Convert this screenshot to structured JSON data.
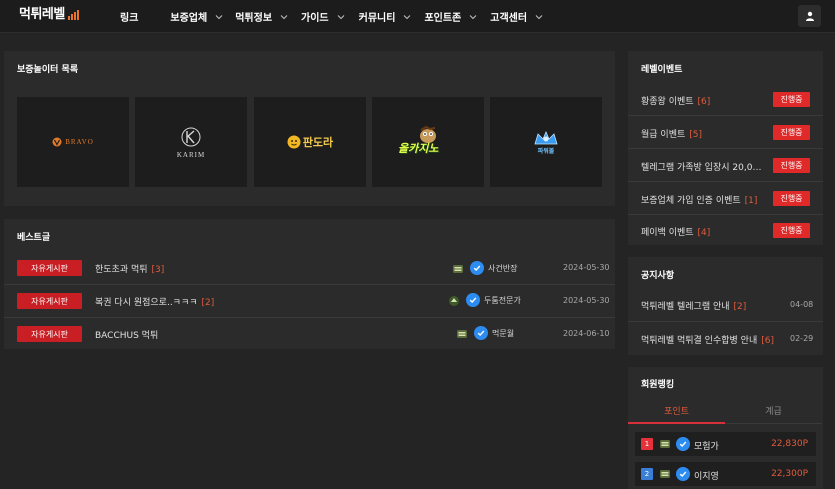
{
  "header": {
    "logo": "먹튀레벨",
    "nav": [
      {
        "label": "링크",
        "dropdown": false
      },
      {
        "label": "보증업체",
        "dropdown": true
      },
      {
        "label": "먹튀정보",
        "dropdown": true
      },
      {
        "label": "가이드",
        "dropdown": true
      },
      {
        "label": "커뮤니티",
        "dropdown": true
      },
      {
        "label": "포인트존",
        "dropdown": true
      },
      {
        "label": "고객센터",
        "dropdown": true
      }
    ],
    "user_icon": "user-icon"
  },
  "partners": {
    "title": "보증놀이터 목록",
    "items": [
      {
        "name": "BRAVO"
      },
      {
        "name": "KARIM"
      },
      {
        "name": "판도라"
      },
      {
        "name": "올카지노"
      },
      {
        "name": "파워볼"
      }
    ]
  },
  "best": {
    "title": "베스트글",
    "posts": [
      {
        "category": "자유게시판",
        "title": "한도초과 먹튀",
        "comments": "[3]",
        "author": "사건반장",
        "date": "2024-05-30"
      },
      {
        "category": "자유게시판",
        "title": "복권 다시 원점으로..ㅋㅋㅋ",
        "comments": "[2]",
        "author": "두툼전문가",
        "date": "2024-05-30"
      },
      {
        "category": "자유게시판",
        "title": "BACCHUS 먹튀",
        "comments": "",
        "author": "먹문월",
        "date": "2024-06-10"
      }
    ]
  },
  "events": {
    "title": "레벨이벤트",
    "items": [
      {
        "title": "황종왕 이벤트",
        "count": "[6]",
        "status": "진행중"
      },
      {
        "title": "월급 이벤트",
        "count": "[5]",
        "status": "진행중"
      },
      {
        "title": "텔레그램 가족방 입장시 20,000…",
        "count": "",
        "status": "진행중"
      },
      {
        "title": "보증업체 가입 인증 이벤트",
        "count": "[1]",
        "status": "진행중"
      },
      {
        "title": "페이백 이벤트",
        "count": "[4]",
        "status": "진행중"
      }
    ]
  },
  "notices": {
    "title": "공지사항",
    "items": [
      {
        "title": "먹튀레벨 텔레그램 안내",
        "count": "[2]",
        "date": "04-08"
      },
      {
        "title": "먹튀레벨 먹튀결 인수합병 안내",
        "count": "[6]",
        "date": "02-29"
      }
    ]
  },
  "ranking": {
    "title": "회원랭킹",
    "tabs": [
      {
        "label": "포인트",
        "active": true
      },
      {
        "label": "계급",
        "active": false
      }
    ],
    "rows": [
      {
        "rank": "1",
        "name": "모험가",
        "points": "22,830P",
        "color": "#e5323a"
      },
      {
        "rank": "2",
        "name": "이지영",
        "points": "22,300P",
        "color": "#3a7ed6"
      }
    ]
  },
  "colors": {
    "accent_red": "#c81e24",
    "status_red": "#e02a2a",
    "comment_orange": "#e25b3c",
    "verify_blue": "#2d8cf0"
  }
}
